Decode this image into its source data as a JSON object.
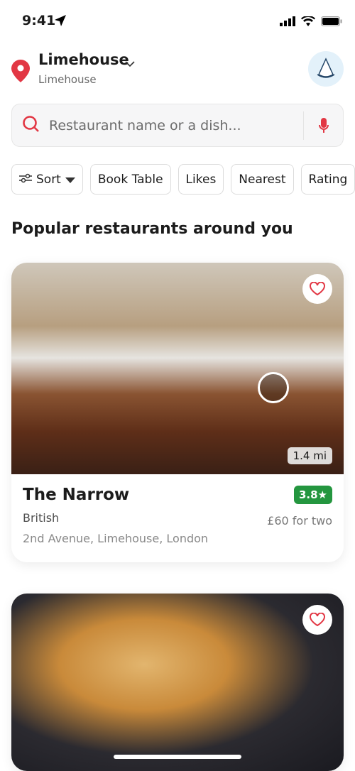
{
  "status": {
    "time": "9:41"
  },
  "location": {
    "title": "Limehouse",
    "subtitle": "Limehouse"
  },
  "search": {
    "placeholder": "Restaurant name or a dish..."
  },
  "filters": [
    "Sort",
    "Book Table",
    "Likes",
    "Nearest",
    "Rating"
  ],
  "section_title": "Popular restaurants around you",
  "restaurants": [
    {
      "name": "The Narrow",
      "rating": "3.8★",
      "cuisine": "British",
      "price": "£60 for two",
      "address": "2nd Avenue, Limehouse, London",
      "distance": "1.4 mi"
    }
  ],
  "colors": {
    "accent": "#e23744",
    "rating": "#24963f"
  }
}
